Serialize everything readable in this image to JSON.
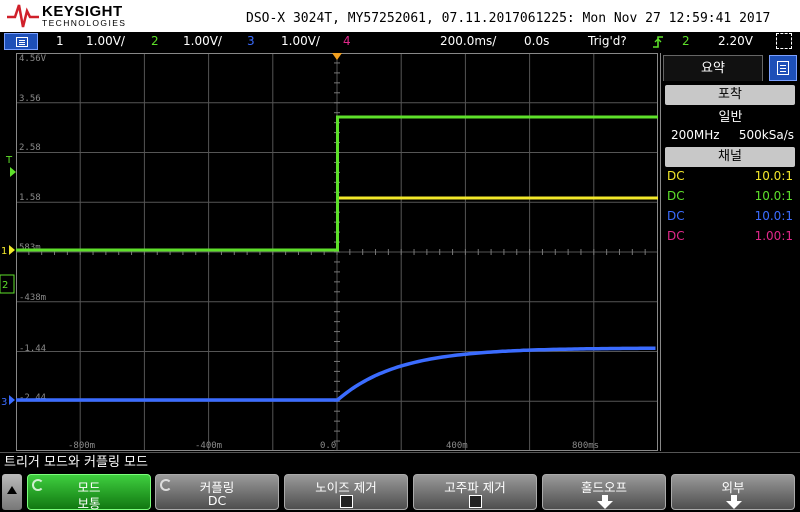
{
  "header": {
    "brand": "KEYSIGHT",
    "brand_sub": "TECHNOLOGIES",
    "info": "DSO-X 3024T, MY57252061, 07.11.2017061225: Mon Nov 27 12:59:41 2017"
  },
  "status": {
    "ch1_num": "1",
    "ch1_scale": "1.00V/",
    "ch2_num": "2",
    "ch2_scale": "1.00V/",
    "ch3_num": "3",
    "ch3_scale": "1.00V/",
    "ch4_num": "4",
    "timebase": "200.0ms/",
    "delay": "0.0s",
    "trig_state": "Trig'd?",
    "trig_source": "2",
    "trig_level": "2.20V"
  },
  "grid": {
    "y_labels": [
      "4.56V",
      "3.56",
      "2.58",
      "1.58",
      "583m",
      "-438m",
      "-1.44",
      "-2.44"
    ],
    "x_labels": [
      "-800m",
      "-400m",
      "0.0",
      "400m",
      "800ms"
    ]
  },
  "channel_markers": {
    "ch1": "1",
    "ch2": "2",
    "ch3": "3",
    "trigger": "T"
  },
  "panel": {
    "tab_summary": "요약",
    "mode_header": "포착",
    "mode_value": "일반",
    "bandwidth": "200MHz",
    "sample_rate": "500kSa/s",
    "channels_header": "채널",
    "channels": [
      {
        "coupling": "DC",
        "probe": "10.0:1",
        "color": "#f2e82a"
      },
      {
        "coupling": "DC",
        "probe": "10.0:1",
        "color": "#5ee02a"
      },
      {
        "coupling": "DC",
        "probe": "10.0:1",
        "color": "#3b6cff"
      },
      {
        "coupling": "DC",
        "probe": "1.00:1",
        "color": "#e0288a"
      }
    ]
  },
  "bottom": {
    "menu_title": "트리거 모드와 커플링 모드",
    "softkeys": [
      {
        "label": "모드",
        "value": "보통"
      },
      {
        "label": "커플링",
        "value": "DC"
      },
      {
        "label": "노이즈 제거",
        "value": ""
      },
      {
        "label": "고주파 제거",
        "value": ""
      },
      {
        "label": "홀드오프",
        "value": ""
      },
      {
        "label": "외부",
        "value": ""
      }
    ]
  },
  "colors": {
    "ch1": "#f2e82a",
    "ch2": "#5ee02a",
    "ch3": "#3b6cff",
    "ch4": "#e0288a",
    "trigger": "#f2a020",
    "grid": "#555555"
  }
}
